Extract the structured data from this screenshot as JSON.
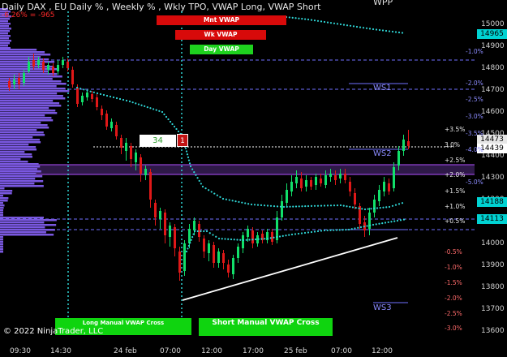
{
  "header": {
    "title": "Daily DAX , EU Daily % , Weekly % , Wkly TPO, VWAP Long, VWAP Short",
    "subtitle": "-6.26% = -965",
    "top_right": "WPP",
    "copyright": "© 2022 NinjaTrader, LLC"
  },
  "buttons": {
    "mnt_vwap": "Mnt VWAP",
    "wk_vwap": "Wk VWAP",
    "day_vwap": "Day VWAP",
    "long_manual": "Long Manual VWAP Cross",
    "short_manual": "Short Manual VWAP Cross"
  },
  "markers": {
    "count": "34",
    "signal": "1"
  },
  "ws_labels": {
    "ws1": "WS1",
    "ws2": "WS2",
    "ws3": "WS3",
    "wpp": "WPP"
  },
  "y_axis": {
    "ticks": [
      "15000",
      "14900",
      "14800",
      "14700",
      "14600",
      "14500",
      "14400",
      "14300",
      "14200",
      "14100",
      "14000",
      "13900",
      "13800",
      "13700",
      "13600"
    ]
  },
  "x_axis": {
    "ticks": [
      "09:30",
      "14:30",
      "24 feb",
      "07:00",
      "12:00",
      "17:00",
      "25 feb",
      "07:00",
      "12:00"
    ]
  },
  "price_tags": [
    {
      "label": "14965",
      "color": "#00d2d2"
    },
    {
      "label": "14473",
      "color": "#e6e6e6"
    },
    {
      "label": "14439",
      "color": "#ffffff"
    },
    {
      "label": "14188",
      "color": "#00d2d2"
    },
    {
      "label": "14113",
      "color": "#00d2d2"
    }
  ],
  "weekly_pct": [
    "-1.0%",
    "-2.0%",
    "-2.5%",
    "-3.0%",
    "-3.5%",
    "-4.0%",
    "-5.0%"
  ],
  "daily_pct": [
    "+3.5%",
    "3.0%",
    "+2.5%",
    "+2.0%",
    "+1.5%",
    "+1.0%",
    "+0.5%",
    "-0.5%",
    "-1.0%",
    "-1.5%",
    "-2.0%",
    "-2.5%",
    "-3.0%"
  ],
  "colors": {
    "up": "#11e06a",
    "down": "#e01818",
    "vwap": "#2fd6d6",
    "profile": "#7a58e0",
    "level_line": "#7070ff"
  },
  "chart_data": {
    "type": "candlestick",
    "title": "Daily DAX",
    "ylim": [
      13550,
      15050
    ],
    "vwap_short": [
      14750,
      14720,
      14600,
      14480,
      14350,
      14250,
      14180,
      14120,
      14080,
      14050,
      14040,
      14050,
      14080,
      14100,
      14110,
      14113
    ],
    "vwap_long": [
      15000,
      14990,
      14980,
      14970,
      14965
    ],
    "trend_line": [
      [
        13740,
        14030
      ]
    ],
    "close_last": 14473
  }
}
